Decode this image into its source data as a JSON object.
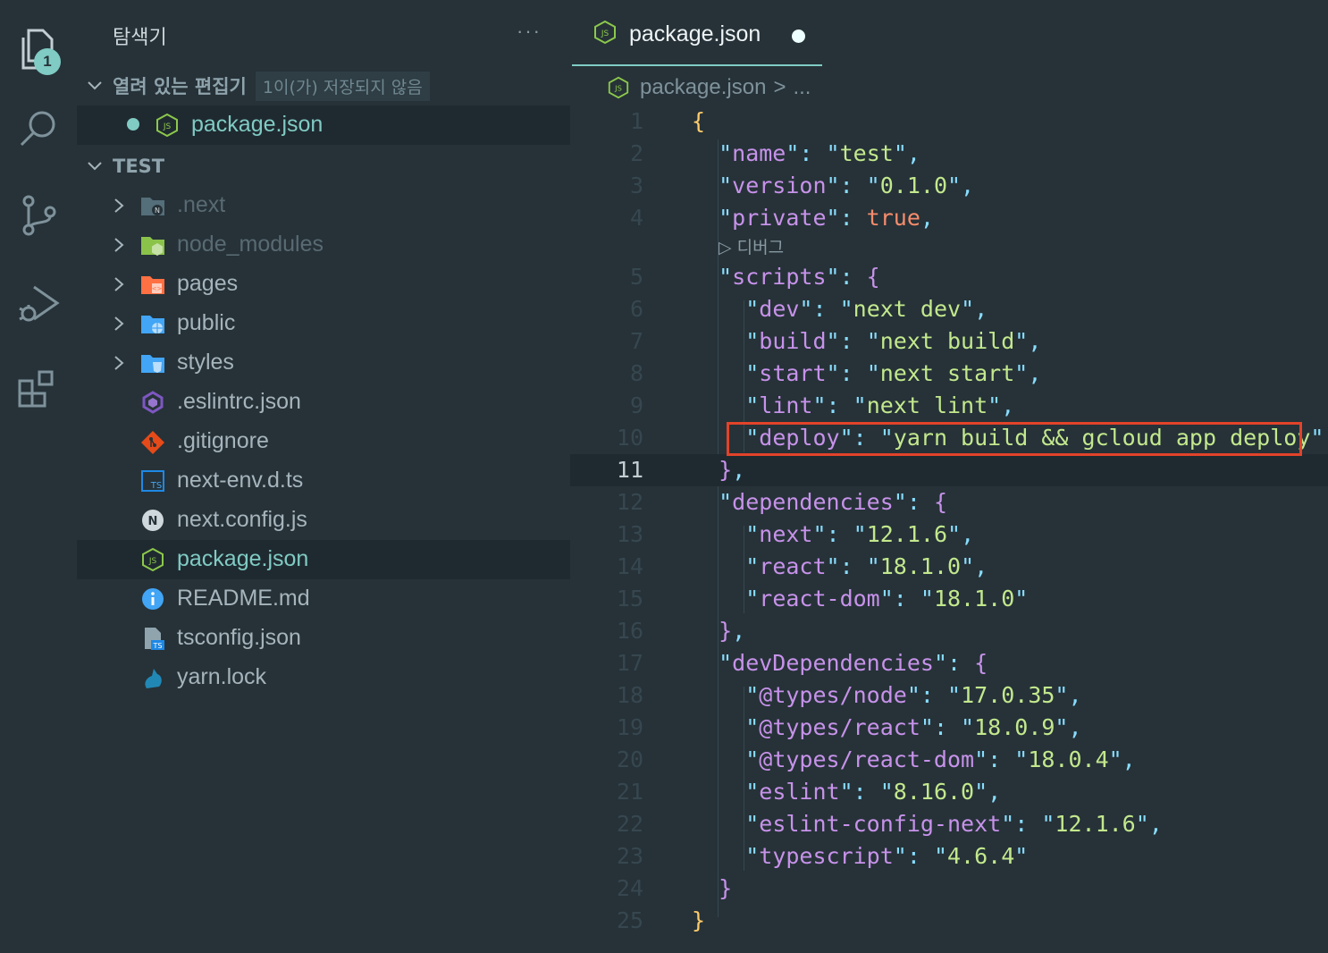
{
  "activity_bar": {
    "explorer_badge": "1",
    "icons": [
      "files-icon",
      "search-icon",
      "source-control-icon",
      "run-debug-icon",
      "extensions-icon"
    ]
  },
  "sidebar": {
    "title": "탐색기",
    "more": "···",
    "open_editors": {
      "label": "열려 있는 편집기",
      "note": "1이(가) 저장되지 않음",
      "files": [
        {
          "name": "package.json",
          "unsaved": true
        }
      ]
    },
    "workspace": {
      "label": "TEST",
      "items": [
        {
          "name": ".next",
          "type": "folder",
          "icon": "next-folder-icon",
          "color": "#596a72"
        },
        {
          "name": "node_modules",
          "type": "folder",
          "icon": "node-folder-icon",
          "color": "#596a72"
        },
        {
          "name": "pages",
          "type": "folder",
          "icon": "pages-folder-icon",
          "color": "#a6b4bb"
        },
        {
          "name": "public",
          "type": "folder",
          "icon": "public-folder-icon",
          "color": "#a6b4bb"
        },
        {
          "name": "styles",
          "type": "folder",
          "icon": "styles-folder-icon",
          "color": "#a6b4bb"
        },
        {
          "name": ".eslintrc.json",
          "type": "file",
          "icon": "eslint-icon",
          "color": "#a6b4bb"
        },
        {
          "name": ".gitignore",
          "type": "file",
          "icon": "git-icon",
          "color": "#a6b4bb"
        },
        {
          "name": "next-env.d.ts",
          "type": "file",
          "icon": "typescript-def-icon",
          "color": "#a6b4bb"
        },
        {
          "name": "next.config.js",
          "type": "file",
          "icon": "next-icon",
          "color": "#a6b4bb"
        },
        {
          "name": "package.json",
          "type": "file",
          "icon": "nodejs-icon",
          "color": "#80cbc4",
          "selected": true
        },
        {
          "name": "README.md",
          "type": "file",
          "icon": "info-icon",
          "color": "#a6b4bb"
        },
        {
          "name": "tsconfig.json",
          "type": "file",
          "icon": "tsconfig-icon",
          "color": "#a6b4bb"
        },
        {
          "name": "yarn.lock",
          "type": "file",
          "icon": "yarn-icon",
          "color": "#a6b4bb"
        }
      ]
    }
  },
  "editor": {
    "tab": {
      "label": "package.json",
      "unsaved": true
    },
    "breadcrumb": {
      "file": "package.json",
      "sep": ">",
      "more": "..."
    },
    "codelens": "▷ 디버그",
    "current_line": 11,
    "lines": [
      {
        "n": "1",
        "tokens": [
          [
            "br-y",
            "{"
          ]
        ]
      },
      {
        "n": "2",
        "tokens": [
          [
            "q",
            "  \""
          ],
          [
            "k",
            "name"
          ],
          [
            "q",
            "\": "
          ],
          [
            "q",
            "\""
          ],
          [
            "s",
            "test"
          ],
          [
            "q",
            "\","
          ]
        ]
      },
      {
        "n": "3",
        "tokens": [
          [
            "q",
            "  \""
          ],
          [
            "k",
            "version"
          ],
          [
            "q",
            "\": "
          ],
          [
            "q",
            "\""
          ],
          [
            "s",
            "0.1.0"
          ],
          [
            "q",
            "\","
          ]
        ]
      },
      {
        "n": "4",
        "tokens": [
          [
            "q",
            "  \""
          ],
          [
            "k",
            "private"
          ],
          [
            "q",
            "\": "
          ],
          [
            "b",
            "true"
          ],
          [
            "q",
            ","
          ]
        ]
      },
      {
        "n": "5",
        "tokens": [
          [
            "q",
            "  \""
          ],
          [
            "k",
            "scripts"
          ],
          [
            "q",
            "\": "
          ],
          [
            "br-m",
            "{"
          ]
        ]
      },
      {
        "n": "6",
        "tokens": [
          [
            "q",
            "    \""
          ],
          [
            "k",
            "dev"
          ],
          [
            "q",
            "\": "
          ],
          [
            "q",
            "\""
          ],
          [
            "s",
            "next dev"
          ],
          [
            "q",
            "\","
          ]
        ]
      },
      {
        "n": "7",
        "tokens": [
          [
            "q",
            "    \""
          ],
          [
            "k",
            "build"
          ],
          [
            "q",
            "\": "
          ],
          [
            "q",
            "\""
          ],
          [
            "s",
            "next build"
          ],
          [
            "q",
            "\","
          ]
        ]
      },
      {
        "n": "8",
        "tokens": [
          [
            "q",
            "    \""
          ],
          [
            "k",
            "start"
          ],
          [
            "q",
            "\": "
          ],
          [
            "q",
            "\""
          ],
          [
            "s",
            "next start"
          ],
          [
            "q",
            "\","
          ]
        ]
      },
      {
        "n": "9",
        "tokens": [
          [
            "q",
            "    \""
          ],
          [
            "k",
            "lint"
          ],
          [
            "q",
            "\": "
          ],
          [
            "q",
            "\""
          ],
          [
            "s",
            "next lint"
          ],
          [
            "q",
            "\","
          ]
        ]
      },
      {
        "n": "10",
        "tokens": [
          [
            "q",
            "    \""
          ],
          [
            "k",
            "deploy"
          ],
          [
            "q",
            "\": "
          ],
          [
            "q",
            "\""
          ],
          [
            "s",
            "yarn build && gcloud app deploy"
          ],
          [
            "q",
            "\""
          ]
        ]
      },
      {
        "n": "11",
        "tokens": [
          [
            "br-m",
            "  }"
          ],
          [
            "q",
            ","
          ]
        ]
      },
      {
        "n": "12",
        "tokens": [
          [
            "q",
            "  \""
          ],
          [
            "k",
            "dependencies"
          ],
          [
            "q",
            "\": "
          ],
          [
            "br-m",
            "{"
          ]
        ]
      },
      {
        "n": "13",
        "tokens": [
          [
            "q",
            "    \""
          ],
          [
            "k",
            "next"
          ],
          [
            "q",
            "\": "
          ],
          [
            "q",
            "\""
          ],
          [
            "s",
            "12.1.6"
          ],
          [
            "q",
            "\","
          ]
        ]
      },
      {
        "n": "14",
        "tokens": [
          [
            "q",
            "    \""
          ],
          [
            "k",
            "react"
          ],
          [
            "q",
            "\": "
          ],
          [
            "q",
            "\""
          ],
          [
            "s",
            "18.1.0"
          ],
          [
            "q",
            "\","
          ]
        ]
      },
      {
        "n": "15",
        "tokens": [
          [
            "q",
            "    \""
          ],
          [
            "k",
            "react-dom"
          ],
          [
            "q",
            "\": "
          ],
          [
            "q",
            "\""
          ],
          [
            "s",
            "18.1.0"
          ],
          [
            "q",
            "\""
          ]
        ]
      },
      {
        "n": "16",
        "tokens": [
          [
            "br-m",
            "  }"
          ],
          [
            "q",
            ","
          ]
        ]
      },
      {
        "n": "17",
        "tokens": [
          [
            "q",
            "  \""
          ],
          [
            "k",
            "devDependencies"
          ],
          [
            "q",
            "\": "
          ],
          [
            "br-m",
            "{"
          ]
        ]
      },
      {
        "n": "18",
        "tokens": [
          [
            "q",
            "    \""
          ],
          [
            "k",
            "@types/node"
          ],
          [
            "q",
            "\": "
          ],
          [
            "q",
            "\""
          ],
          [
            "s",
            "17.0.35"
          ],
          [
            "q",
            "\","
          ]
        ]
      },
      {
        "n": "19",
        "tokens": [
          [
            "q",
            "    \""
          ],
          [
            "k",
            "@types/react"
          ],
          [
            "q",
            "\": "
          ],
          [
            "q",
            "\""
          ],
          [
            "s",
            "18.0.9"
          ],
          [
            "q",
            "\","
          ]
        ]
      },
      {
        "n": "20",
        "tokens": [
          [
            "q",
            "    \""
          ],
          [
            "k",
            "@types/react-dom"
          ],
          [
            "q",
            "\": "
          ],
          [
            "q",
            "\""
          ],
          [
            "s",
            "18.0.4"
          ],
          [
            "q",
            "\","
          ]
        ]
      },
      {
        "n": "21",
        "tokens": [
          [
            "q",
            "    \""
          ],
          [
            "k",
            "eslint"
          ],
          [
            "q",
            "\": "
          ],
          [
            "q",
            "\""
          ],
          [
            "s",
            "8.16.0"
          ],
          [
            "q",
            "\","
          ]
        ]
      },
      {
        "n": "22",
        "tokens": [
          [
            "q",
            "    \""
          ],
          [
            "k",
            "eslint-config-next"
          ],
          [
            "q",
            "\": "
          ],
          [
            "q",
            "\""
          ],
          [
            "s",
            "12.1.6"
          ],
          [
            "q",
            "\","
          ]
        ]
      },
      {
        "n": "23",
        "tokens": [
          [
            "q",
            "    \""
          ],
          [
            "k",
            "typescript"
          ],
          [
            "q",
            "\": "
          ],
          [
            "q",
            "\""
          ],
          [
            "s",
            "4.6.4"
          ],
          [
            "q",
            "\""
          ]
        ]
      },
      {
        "n": "24",
        "tokens": [
          [
            "br-m",
            "  }"
          ]
        ]
      },
      {
        "n": "25",
        "tokens": [
          [
            "br-y",
            "}"
          ]
        ]
      }
    ]
  }
}
